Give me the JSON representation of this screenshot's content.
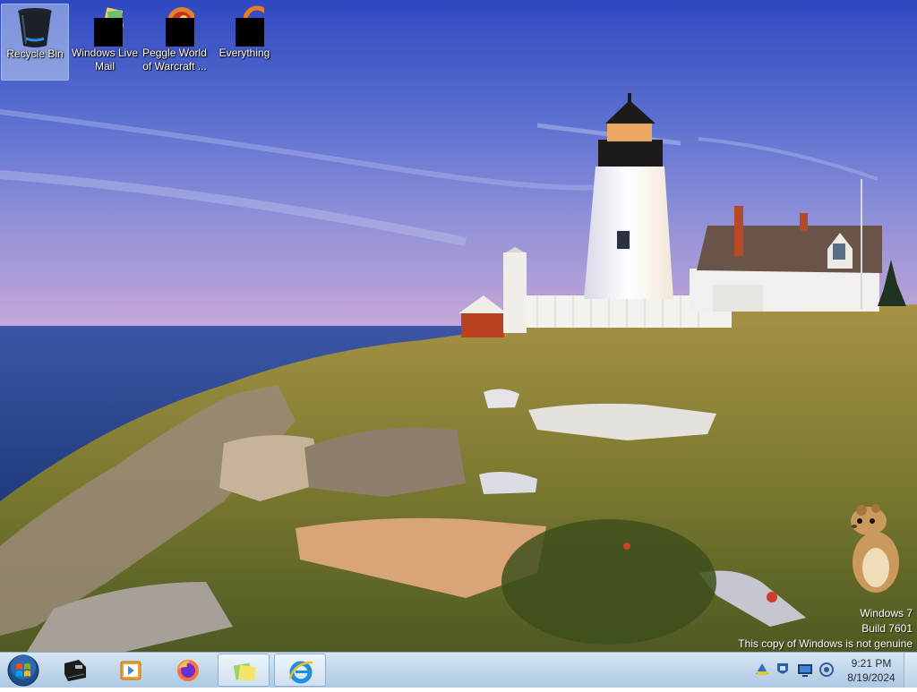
{
  "desktop": {
    "icons": [
      {
        "label": "Recycle Bin",
        "icon": "recycle-bin-icon"
      },
      {
        "label": "Windows Live Mail",
        "icon": "windows-live-mail-icon"
      },
      {
        "label": "Peggle World of Warcraft ...",
        "icon": "peggle-icon"
      },
      {
        "label": "Everything",
        "icon": "everything-icon"
      }
    ]
  },
  "watermark": {
    "line1": "Windows 7",
    "line2": "Build 7601",
    "line3": "This copy of Windows is not genuine"
  },
  "taskbar": {
    "start": {
      "icon": "windows-start-orb-icon"
    },
    "pinned": [
      {
        "icon": "printer-scanner-icon",
        "open": false
      },
      {
        "icon": "media-player-icon",
        "open": false
      },
      {
        "icon": "firefox-icon",
        "open": false
      },
      {
        "icon": "sticky-notes-icon",
        "open": true
      },
      {
        "icon": "internet-explorer-icon",
        "open": true
      }
    ],
    "tray_icons": [
      "action-center-icon",
      "network-shield-icon",
      "display-icon",
      "volume-icon"
    ],
    "clock": {
      "time": "9:21 PM",
      "date": "8/19/2024"
    }
  },
  "colors": {
    "taskbar": "#c3d8ec",
    "sky_top": "#3a55c6",
    "sea": "#2f4e9a",
    "grass": "#8a8a3a"
  }
}
